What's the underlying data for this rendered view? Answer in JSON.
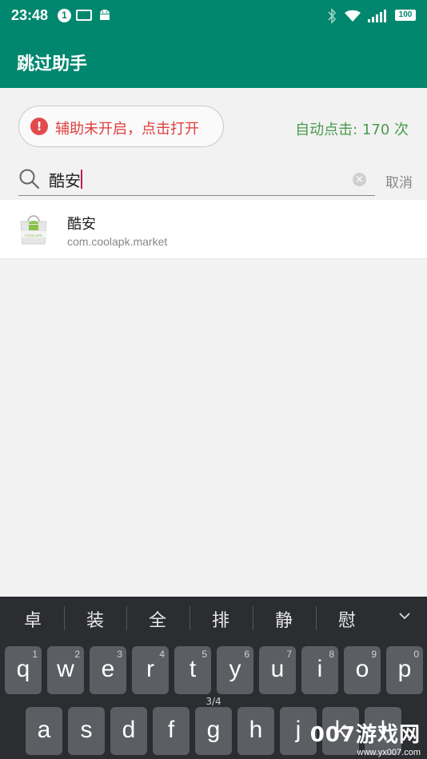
{
  "status_bar": {
    "time": "23:48",
    "notification_count": "1",
    "battery": "100"
  },
  "app_bar": {
    "title": "跳过助手"
  },
  "accessibility_button": {
    "label": "辅助未开启，点击打开",
    "icon": "!"
  },
  "auto_click": {
    "label": "自动点击: 170 次"
  },
  "search": {
    "value": "酷安",
    "cancel_label": "取消"
  },
  "results": [
    {
      "name": "酷安",
      "package": "com.coolapk.market",
      "icon_text": "COOLAPK"
    }
  ],
  "keyboard": {
    "suggestions": [
      "卓",
      "装",
      "全",
      "排",
      "静",
      "慰"
    ],
    "row1": [
      {
        "key": "q",
        "hint": "1"
      },
      {
        "key": "w",
        "hint": "2"
      },
      {
        "key": "e",
        "hint": "3"
      },
      {
        "key": "r",
        "hint": "4"
      },
      {
        "key": "t",
        "hint": "5"
      },
      {
        "key": "y",
        "hint": "6"
      },
      {
        "key": "u",
        "hint": "7"
      },
      {
        "key": "i",
        "hint": "8"
      },
      {
        "key": "o",
        "hint": "9"
      },
      {
        "key": "p",
        "hint": "0"
      }
    ],
    "row2": [
      {
        "key": "a"
      },
      {
        "key": "s"
      },
      {
        "key": "d"
      },
      {
        "key": "f"
      },
      {
        "key": "g",
        "hint": "3/4"
      },
      {
        "key": "h"
      },
      {
        "key": "j"
      },
      {
        "key": "k"
      },
      {
        "key": "l"
      }
    ]
  },
  "watermark": {
    "brand": "007游戏网",
    "url": "www.yx007.com"
  }
}
